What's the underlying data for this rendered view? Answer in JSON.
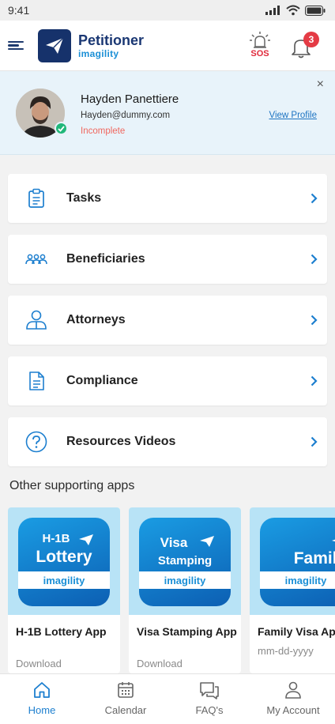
{
  "status_bar": {
    "time": "9:41"
  },
  "header": {
    "app_name": "Petitioner",
    "brand_sub": "imagility",
    "sos_label": "SOS",
    "notification_count": "3"
  },
  "profile": {
    "name": "Hayden Panettiere",
    "email": "Hayden@dummy.com",
    "status": "Incomplete",
    "view_profile": "View Profile",
    "close": "×"
  },
  "menu": [
    {
      "label": "Tasks",
      "icon": "clipboard-icon"
    },
    {
      "label": "Beneficiaries",
      "icon": "people-group-icon"
    },
    {
      "label": "Attorneys",
      "icon": "users-icon"
    },
    {
      "label": "Compliance",
      "icon": "document-icon"
    },
    {
      "label": "Resources Videos",
      "icon": "question-circle-icon"
    }
  ],
  "other_apps": {
    "title": "Other supporting apps",
    "apps": [
      {
        "tile_line1": "H-1B",
        "tile_line2": "Lottery",
        "tile_brand": "imagility",
        "title": "H-1B Lottery App",
        "subtitle": "Download"
      },
      {
        "tile_line1": "Visa",
        "tile_line2": "Stamping",
        "tile_brand": "imagility",
        "title": "Visa Stamping App",
        "subtitle": "Download"
      },
      {
        "tile_line1": "",
        "tile_line2": "Family",
        "tile_brand": "imagility",
        "title": "Family Visa Ap",
        "subtitle": "mm-dd-yyyy"
      }
    ]
  },
  "bottom_nav": [
    {
      "label": "Home",
      "icon": "home-icon",
      "active": true
    },
    {
      "label": "Calendar",
      "icon": "calendar-icon",
      "active": false
    },
    {
      "label": "FAQ's",
      "icon": "chat-icon",
      "active": false
    },
    {
      "label": "My Account",
      "icon": "user-icon",
      "active": false
    }
  ],
  "colors": {
    "brand_navy": "#1a3773",
    "accent_blue": "#1d7fcf",
    "sos_red": "#e0293b",
    "incomplete": "#f0675e"
  }
}
